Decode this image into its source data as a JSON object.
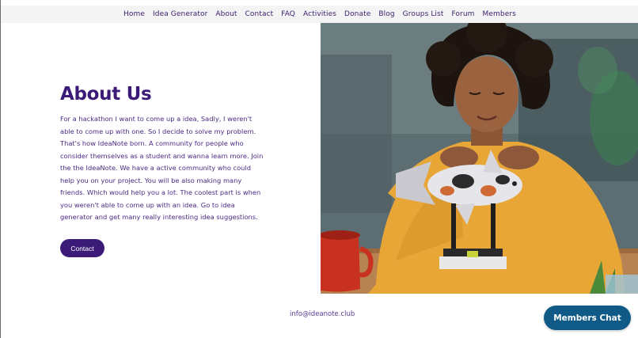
{
  "nav": {
    "items": [
      {
        "label": "Home"
      },
      {
        "label": "Idea Generator"
      },
      {
        "label": "About"
      },
      {
        "label": "Contact"
      },
      {
        "label": "FAQ"
      },
      {
        "label": "Activities"
      },
      {
        "label": "Donate"
      },
      {
        "label": "Blog"
      },
      {
        "label": "Groups List"
      },
      {
        "label": "Forum"
      },
      {
        "label": "Members"
      }
    ]
  },
  "about": {
    "title": "About Us",
    "body": "For a hackathon I want to come up a idea, Sadly, I weren't able to come up with one. So I decide to solve my problem. That's how IdeaNote born. A community for people who consider themselves as a student and wanna learn more. Join the the IdeaNote. We have a active community who could help you on your project. You will be also making many friends. Which would help you a lot. The coolest part is when you weren't able to come up with an idea. Go to idea generator and get many really interesting idea suggestions.",
    "button_label": "Contact"
  },
  "footer": {
    "email": "info@ideanote.club"
  },
  "chat": {
    "label": "Members Chat"
  },
  "colors": {
    "brand_purple": "#3b1a78",
    "chat_blue": "#0f5a86"
  }
}
